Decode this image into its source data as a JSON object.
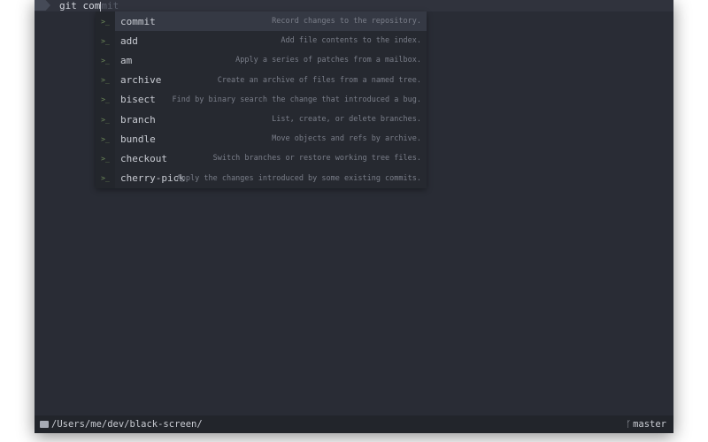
{
  "prompt": {
    "typed": "git com",
    "suggestion": "mit"
  },
  "autocomplete": [
    {
      "name": "commit",
      "description": "Record changes to the repository.",
      "selected": true
    },
    {
      "name": "add",
      "description": "Add file contents to the index."
    },
    {
      "name": "am",
      "description": "Apply a series of patches from a mailbox."
    },
    {
      "name": "archive",
      "description": "Create an archive of files from a named tree."
    },
    {
      "name": "bisect",
      "description": "Find by binary search the change that introduced a bug."
    },
    {
      "name": "branch",
      "description": "List, create, or delete branches."
    },
    {
      "name": "bundle",
      "description": "Move objects and refs by archive."
    },
    {
      "name": "checkout",
      "description": "Switch branches or restore working tree files."
    },
    {
      "name": "cherry-pick",
      "description": "Apply the changes introduced by some existing commits."
    }
  ],
  "icon_glyph": ">_",
  "status": {
    "path": "/Users/me/dev/black-screen/",
    "branch": "master"
  }
}
